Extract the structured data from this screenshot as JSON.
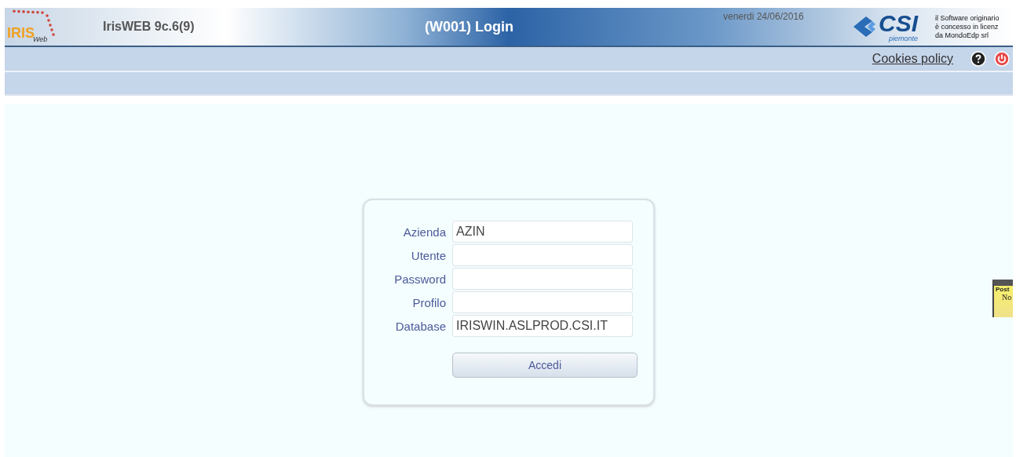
{
  "header": {
    "logo": {
      "main": "IRIS",
      "sub": "Web"
    },
    "app_name": "Iris**WEB** 9c.6(9)",
    "title": "(W001) Login",
    "date": "venerdi 24/06/2016",
    "partner_logo": {
      "main": "CSI",
      "sub": "piemonte"
    },
    "license_lines": [
      "il Software originario",
      "è concesso in licenz",
      "da MondoEdp srl"
    ]
  },
  "toolbar": {
    "link": "Cookies policy"
  },
  "login_form": {
    "fields": [
      {
        "label": "Azienda",
        "value": "AZIN"
      },
      {
        "label": "Utente"
      },
      {
        "label": "Password"
      },
      {
        "label": "Profilo"
      },
      {
        "label": "Database",
        "value": "IRISWIN.ASLPROD.CSI.IT"
      }
    ],
    "submit": "Accedi"
  },
  "side_widget": {
    "lines": [
      "Post",
      "No"
    ]
  }
}
